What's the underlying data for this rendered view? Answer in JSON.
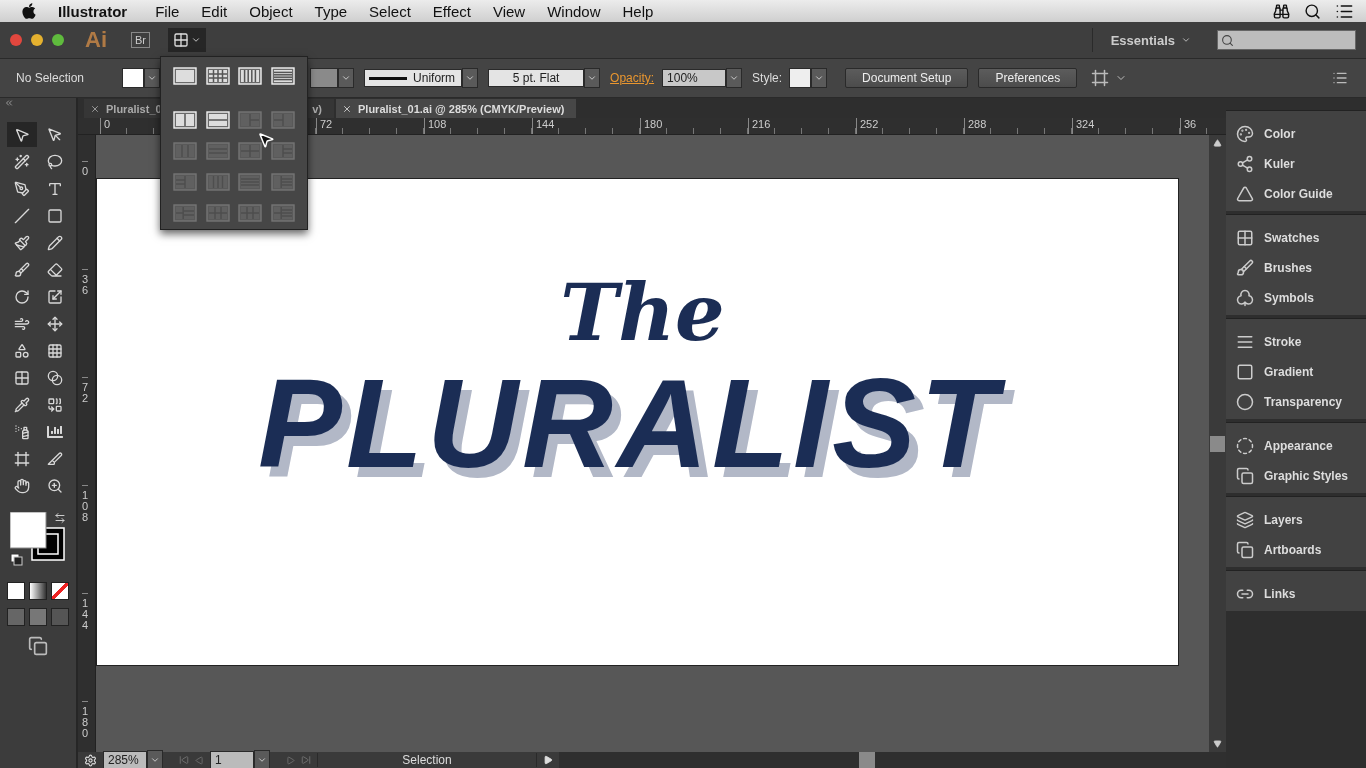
{
  "menu_bar": {
    "app_name": "Illustrator",
    "items": [
      "File",
      "Edit",
      "Object",
      "Type",
      "Select",
      "Effect",
      "View",
      "Window",
      "Help"
    ]
  },
  "app_bar": {
    "logo": "Ai",
    "bridge": "Br",
    "arrange_expanded": true,
    "workspace": "Essentials"
  },
  "control_bar": {
    "selection": "No Selection",
    "stroke_profile": "Uniform",
    "brush": "5 pt. Flat",
    "opacity_label": "Opacity:",
    "opacity": "100%",
    "style_label": "Style:",
    "buttons": [
      "Document Setup",
      "Preferences"
    ]
  },
  "arrange_menu": {
    "tiles": [
      {
        "kind": "single",
        "disabled": false
      },
      {
        "kind": "grid",
        "disabled": false
      },
      {
        "kind": "columns",
        "disabled": false
      },
      {
        "kind": "rows",
        "disabled": false
      },
      {
        "kind": "two-cols",
        "disabled": false
      },
      {
        "kind": "two-rows",
        "disabled": false
      },
      {
        "kind": "three-right",
        "disabled": true
      },
      {
        "kind": "three-left",
        "disabled": true
      },
      {
        "kind": "three-cols",
        "disabled": true
      },
      {
        "kind": "three-rows",
        "disabled": true
      },
      {
        "kind": "four-grid",
        "disabled": true
      },
      {
        "kind": "four-left",
        "disabled": true
      },
      {
        "kind": "four-right",
        "disabled": true
      },
      {
        "kind": "four-cols",
        "disabled": true
      },
      {
        "kind": "four-rows",
        "disabled": true
      },
      {
        "kind": "five-left",
        "disabled": true
      },
      {
        "kind": "five-right",
        "disabled": true
      },
      {
        "kind": "six-grid",
        "disabled": true
      },
      {
        "kind": "six-grid",
        "disabled": true
      },
      {
        "kind": "six-left",
        "disabled": true
      }
    ]
  },
  "tabs": [
    {
      "label": "Pluralist_0",
      "label_tail": "v)",
      "selected": false
    },
    {
      "label": "Pluralist_01.ai @ 285% (CMYK/Preview)",
      "selected": true
    }
  ],
  "rulers": {
    "horizontal": [
      "0",
      "72",
      "108",
      "144",
      "180",
      "216",
      "252",
      "288",
      "324",
      "36"
    ],
    "vertical": [
      "0",
      "36",
      "72",
      "108",
      "144",
      "180"
    ]
  },
  "artwork": {
    "title": "The",
    "headline": "PLURALIST"
  },
  "tools": [
    {
      "kind": "selection",
      "selected": true
    },
    {
      "kind": "direct",
      "selected": false
    },
    {
      "kind": "wand",
      "selected": false
    },
    {
      "kind": "lasso",
      "selected": false
    },
    {
      "kind": "pen",
      "selected": false
    },
    {
      "kind": "type",
      "selected": false
    },
    {
      "kind": "line",
      "selected": false
    },
    {
      "kind": "rect",
      "selected": false
    },
    {
      "kind": "paintbrush",
      "selected": false
    },
    {
      "kind": "pencil",
      "selected": false
    },
    {
      "kind": "blob",
      "selected": false
    },
    {
      "kind": "eraser",
      "selected": false
    },
    {
      "kind": "rotate",
      "selected": false
    },
    {
      "kind": "scale",
      "selected": false
    },
    {
      "kind": "warp",
      "selected": false
    },
    {
      "kind": "transform",
      "selected": false
    },
    {
      "kind": "shapebuilder",
      "selected": false
    },
    {
      "kind": "perspective",
      "selected": false
    },
    {
      "kind": "mesh",
      "selected": false
    },
    {
      "kind": "gradient",
      "selected": false
    },
    {
      "kind": "eyedropper",
      "selected": false
    },
    {
      "kind": "blend",
      "selected": false
    },
    {
      "kind": "spray",
      "selected": false
    },
    {
      "kind": "graph",
      "selected": false
    },
    {
      "kind": "artboard",
      "selected": false
    },
    {
      "kind": "slice",
      "selected": false
    },
    {
      "kind": "hand",
      "selected": false
    },
    {
      "kind": "zoom",
      "selected": false
    }
  ],
  "panels": [
    [
      {
        "kind": "color",
        "label": "Color"
      },
      {
        "kind": "kuler",
        "label": "Kuler"
      },
      {
        "kind": "guide",
        "label": "Color Guide"
      }
    ],
    [
      {
        "kind": "swatches",
        "label": "Swatches"
      },
      {
        "kind": "brushes",
        "label": "Brushes"
      },
      {
        "kind": "symbols",
        "label": "Symbols"
      }
    ],
    [
      {
        "kind": "stroke",
        "label": "Stroke"
      },
      {
        "kind": "gradient",
        "label": "Gradient"
      },
      {
        "kind": "transparency",
        "label": "Transparency"
      }
    ],
    [
      {
        "kind": "appearance",
        "label": "Appearance"
      },
      {
        "kind": "styles",
        "label": "Graphic Styles"
      }
    ],
    [
      {
        "kind": "layers",
        "label": "Layers"
      },
      {
        "kind": "artboards",
        "label": "Artboards"
      }
    ],
    [
      {
        "kind": "links",
        "label": "Links"
      }
    ]
  ],
  "status_bar": {
    "zoom": "285%",
    "page": "1",
    "tool": "Selection"
  }
}
